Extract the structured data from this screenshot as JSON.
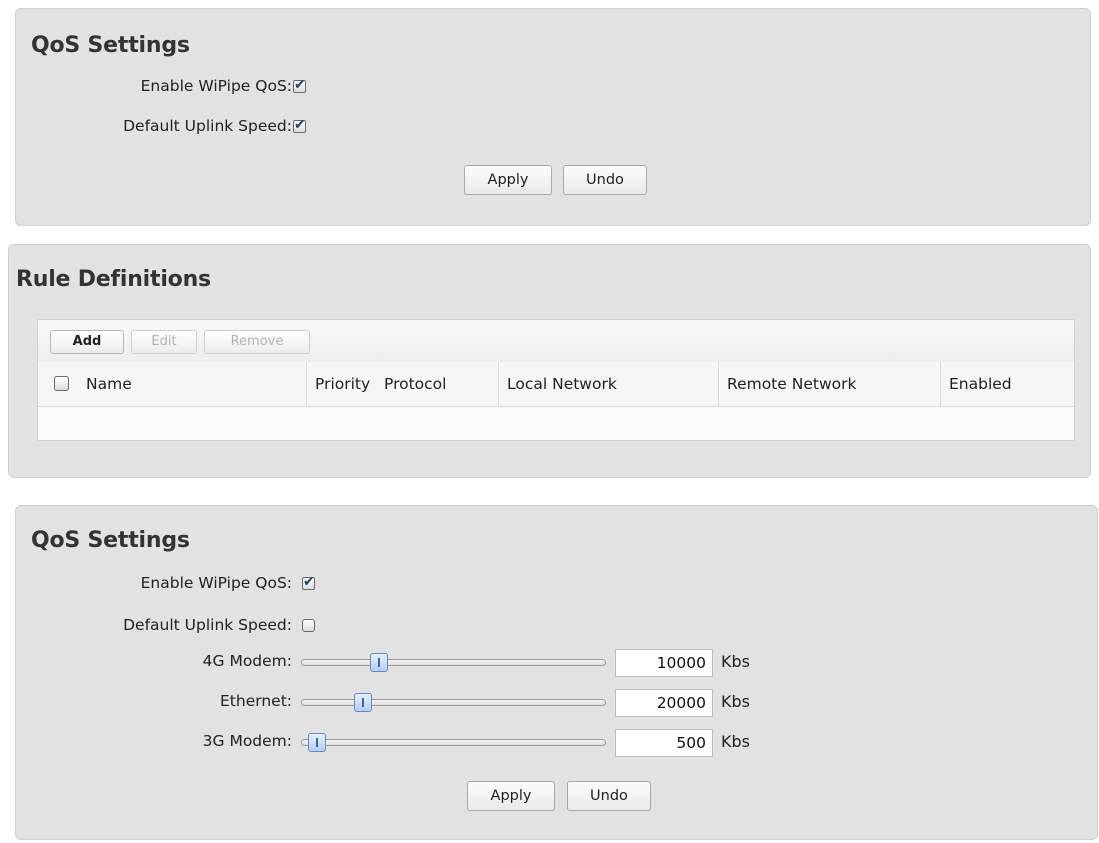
{
  "panel1": {
    "title": "QoS Settings",
    "enable_label": "Enable WiPipe QoS:",
    "enable_checked": true,
    "uplink_label": "Default Uplink Speed:",
    "uplink_checked": true,
    "apply_label": "Apply",
    "undo_label": "Undo"
  },
  "rules": {
    "title": "Rule Definitions",
    "add_label": "Add",
    "edit_label": "Edit",
    "remove_label": "Remove",
    "columns": [
      "Name",
      "Priority",
      "Protocol",
      "Local Network",
      "Remote Network",
      "Enabled"
    ]
  },
  "panel2": {
    "title": "QoS Settings",
    "enable_label": "Enable WiPipe QoS:",
    "enable_checked": true,
    "uplink_label": "Default Uplink Speed:",
    "uplink_checked": false,
    "sliders": [
      {
        "label": "4G Modem:",
        "value": "10000",
        "unit": "Kbs"
      },
      {
        "label": "Ethernet:",
        "value": "20000",
        "unit": "Kbs"
      },
      {
        "label": "3G Modem:",
        "value": "500",
        "unit": "Kbs"
      }
    ],
    "apply_label": "Apply",
    "undo_label": "Undo"
  }
}
